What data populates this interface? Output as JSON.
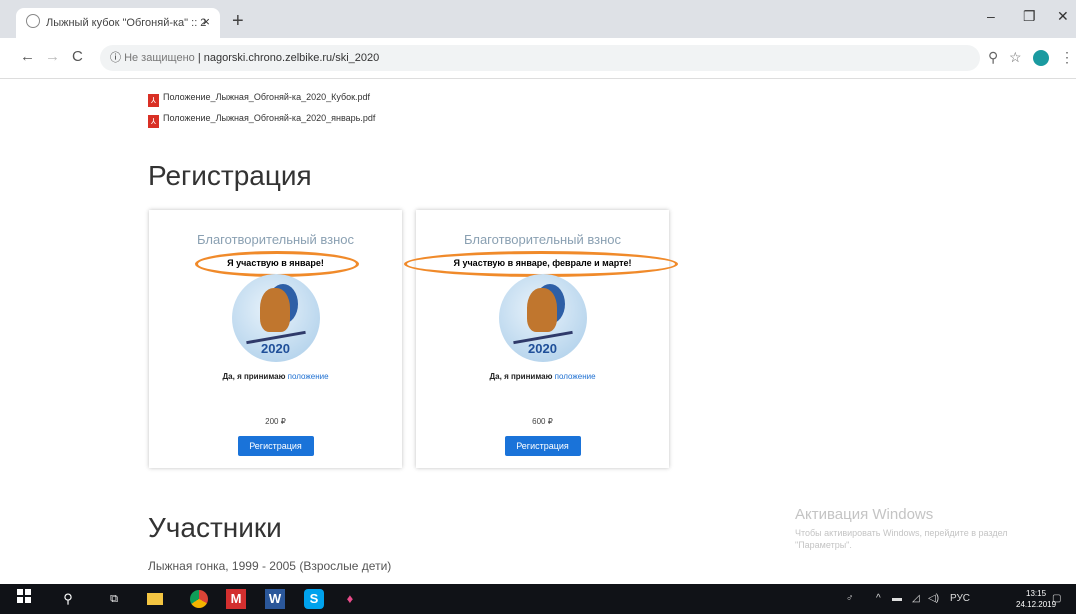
{
  "browser": {
    "tab_title": "Лыжный кубок \"Обгоняй-ка\" :: 2",
    "tab_close": "×",
    "new_tab": "+",
    "minimize": "–",
    "maximize": "❐",
    "close": "✕",
    "back": "←",
    "forward": "→",
    "reload": "C",
    "insecure_label": "Не защищено",
    "url": "nagorski.chrono.zelbike.ru/ski_2020",
    "zoom_icon": "⚲",
    "star_icon": "☆",
    "menu_icon": "⋮"
  },
  "page": {
    "pdf_links": [
      "Положение_Лыжная_Обгоняй-ка_2020_Кубок.pdf",
      "Положение_Лыжная_Обгоняй-ка_2020_январь.pdf"
    ],
    "registration_heading": "Регистрация",
    "cards": [
      {
        "title": "Благотворительный взнос",
        "subtitle": "Я участвую в январе!",
        "logo_year": "2020",
        "agree_text": "Да, я принимаю",
        "agree_link": "положение",
        "price": "200 ₽",
        "button": "Регистрация"
      },
      {
        "title": "Благотворительный взнос",
        "subtitle": "Я участвую в январе, феврале и марте!",
        "logo_year": "2020",
        "agree_text": "Да, я принимаю",
        "agree_link": "положение",
        "price": "600 ₽",
        "button": "Регистрация"
      }
    ],
    "participants_heading": "Участники",
    "category": "Лыжная гонка, 1999 - 2005 (Взрослые дети)",
    "activation": {
      "title": "Активация Windows",
      "text": "Чтобы активировать Windows, перейдите в раздел \"Параметры\"."
    }
  },
  "taskbar": {
    "search": "⚲",
    "lang": "РУС",
    "time": "13:15",
    "date": "24.12.2019"
  },
  "colors": {
    "highlight": "#f08a2a",
    "button": "#1a73d9",
    "link": "#1d6fd1"
  }
}
